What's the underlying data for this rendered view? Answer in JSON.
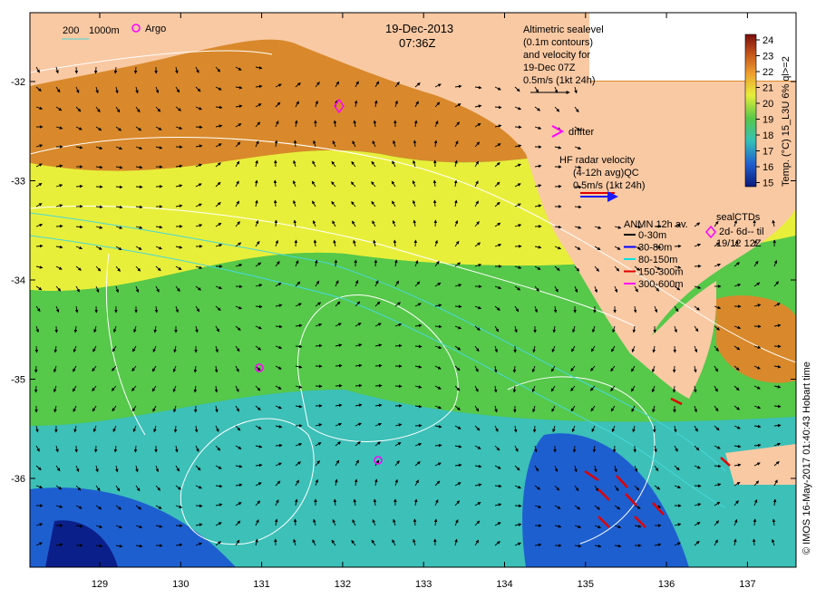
{
  "header": {
    "date": "19-Dec-2013",
    "time": "07:36Z"
  },
  "depth_legend": {
    "d200": "200",
    "d1000": "1000m"
  },
  "argo_label": "Argo",
  "altimetry": {
    "lines": [
      "Altimetric sealevel",
      "(0.1m contours)",
      "and velocity for",
      "19-Dec 07Z"
    ],
    "scale": "0.5m/s (1kt 24h)"
  },
  "drifter_label": "drifter",
  "hf_radar": {
    "lines": [
      "HF radar velocity",
      "(4-12h avg)QC"
    ],
    "scale": "0.5m/s (1kt 24h)"
  },
  "anmn": {
    "title": "ANMN 12h av.",
    "items": [
      {
        "label": "0-30m",
        "color": "#000000"
      },
      {
        "label": "30-80m",
        "color": "#0000ff"
      },
      {
        "label": "80-150m",
        "color": "#00e0e0"
      },
      {
        "label": "150-300m",
        "color": "#e00000"
      },
      {
        "label": "300-600m",
        "color": "#ff00ff"
      }
    ]
  },
  "seal_ctds": {
    "title": "sealCTDs",
    "range": "2d- 6d-- til",
    "date": "19/12 12Z"
  },
  "colorbar": {
    "label": "Temp. (°C) 15_L3U 6% ql>=2",
    "ticks": [
      "24",
      "23",
      "22",
      "21",
      "20",
      "19",
      "18",
      "17",
      "16",
      "15"
    ]
  },
  "credit": "© IMOS 16-May-2017 01:40:43 Hobart time",
  "axes": {
    "lon_ticks": [
      "129",
      "130",
      "131",
      "132",
      "133",
      "134",
      "135",
      "136",
      "137"
    ],
    "lat_ticks": [
      "-32",
      "-33",
      "-34",
      "-35",
      "-36"
    ]
  },
  "colors": {
    "land": "#f9c9a3",
    "warm": "#d9892b",
    "yellow": "#e8ef3a",
    "green": "#3fbf4a",
    "cyan": "#3cc0c8",
    "blue": "#1e5fd0",
    "navy": "#0b1f8a"
  }
}
